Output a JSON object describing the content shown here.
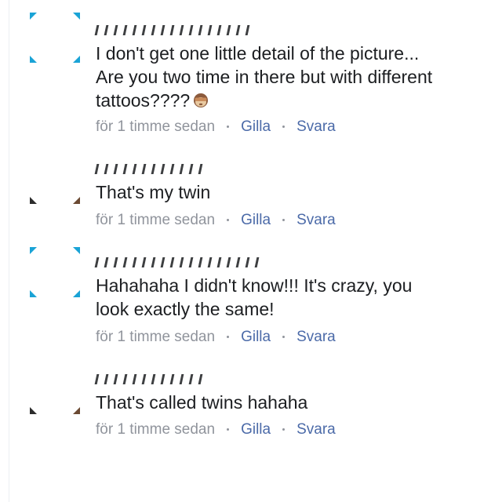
{
  "comments": [
    {
      "author_redacted": true,
      "lines": [
        "I don't get one little detail of the picture...",
        "Are you two time in there but with different",
        "tattoos????"
      ],
      "emoji": "see-no-evil-monkey-icon",
      "time": "för 1 timme sedan",
      "like_label": "Gilla",
      "reply_label": "Svara"
    },
    {
      "author_redacted": true,
      "lines": [
        "That's my twin"
      ],
      "time": "för 1 timme sedan",
      "like_label": "Gilla",
      "reply_label": "Svara"
    },
    {
      "author_redacted": true,
      "lines": [
        "Hahahaha I didn't know!!! It's crazy, you",
        "look exactly the same!"
      ],
      "time": "för 1 timme sedan",
      "like_label": "Gilla",
      "reply_label": "Svara"
    },
    {
      "author_redacted": true,
      "lines": [
        "That's called twins hahaha"
      ],
      "time": "för 1 timme sedan",
      "like_label": "Gilla",
      "reply_label": "Svara"
    }
  ],
  "colors": {
    "text": "#1c1e21",
    "meta": "#90949c",
    "action": "#4b6aa8",
    "avatar_accent": "#1aa3d6"
  }
}
